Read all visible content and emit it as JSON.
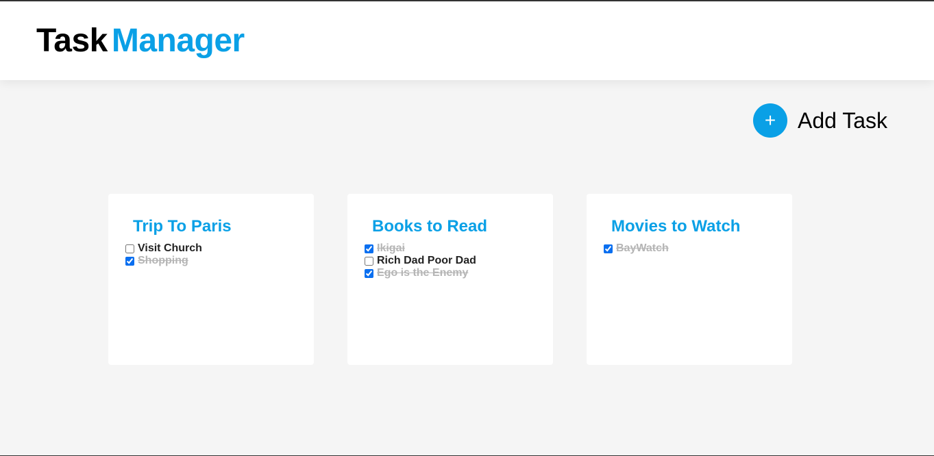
{
  "header": {
    "title_part1": "Task",
    "title_part2": "Manager"
  },
  "add_task": {
    "icon": "plus-icon",
    "icon_glyph": "+",
    "label": "Add Task"
  },
  "colors": {
    "accent": "#0aa0e6",
    "background": "#f5f5f5",
    "card": "#ffffff",
    "done_text": "#b5b5b5"
  },
  "lists": [
    {
      "title": "Trip To Paris",
      "tasks": [
        {
          "text": "Visit Church",
          "done": false
        },
        {
          "text": "Shopping",
          "done": true
        }
      ]
    },
    {
      "title": "Books to Read",
      "tasks": [
        {
          "text": "Ikigai",
          "done": true
        },
        {
          "text": "Rich Dad Poor Dad",
          "done": false
        },
        {
          "text": "Ego is the Enemy",
          "done": true
        }
      ]
    },
    {
      "title": "Movies to Watch",
      "tasks": [
        {
          "text": "BayWatch",
          "done": true
        }
      ]
    }
  ]
}
